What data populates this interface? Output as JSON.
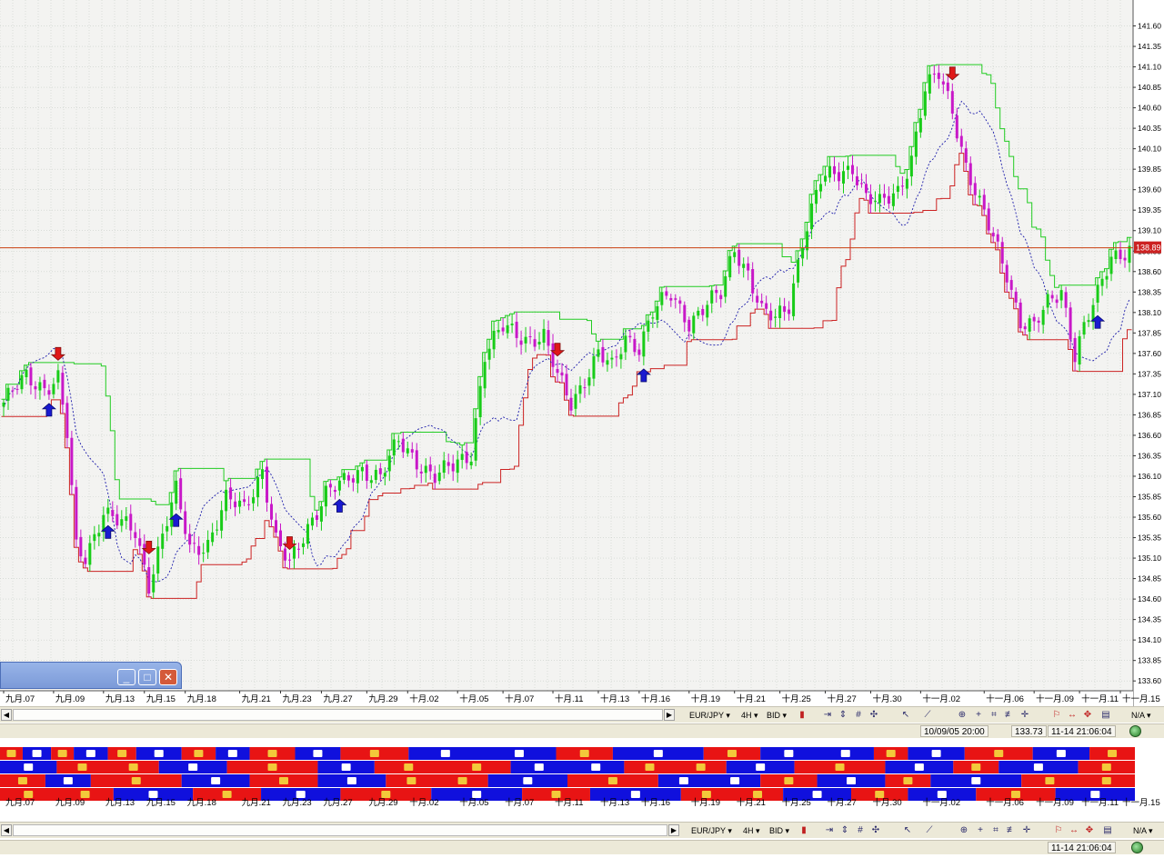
{
  "colors": {
    "background": "#f3f3f1",
    "grid": "#c9cfc9",
    "bull_candle": "#18cc18",
    "bear_candle": "#c818c8",
    "channel_upper": "#22cc22",
    "channel_lower": "#cc2222",
    "stop_line": "#1a1aaa",
    "price_line": "#c84010",
    "price_tag_bg": "#cc2222",
    "heat_bull": "#e81414",
    "heat_bear": "#1010dd"
  },
  "chart_data": {
    "type": "candlestick",
    "symbol": "EUR/JPY",
    "timeframe": "4H",
    "price_side": "BID",
    "y_ticks": [
      "141.60",
      "141.35",
      "141.10",
      "140.85",
      "140.60",
      "140.35",
      "140.10",
      "139.85",
      "139.60",
      "139.35",
      "139.10",
      "138.85",
      "138.60",
      "138.35",
      "138.10",
      "137.85",
      "137.60",
      "137.35",
      "137.10",
      "136.85",
      "136.60",
      "136.35",
      "136.10",
      "135.85",
      "135.60",
      "135.35",
      "135.10",
      "134.85",
      "134.60",
      "134.35",
      "134.10",
      "133.85",
      "133.60"
    ],
    "ylim": [
      133.48,
      141.85
    ],
    "current_price": "138.89",
    "current_price_value": 138.89,
    "x_ticks": [
      {
        "t": 0,
        "label": "九月.07"
      },
      {
        "t": 11,
        "label": "九月.09"
      },
      {
        "t": 22,
        "label": "九月.13"
      },
      {
        "t": 31,
        "label": "九月.15"
      },
      {
        "t": 40,
        "label": "九月.18"
      },
      {
        "t": 52,
        "label": "九月.21"
      },
      {
        "t": 61,
        "label": "九月.23"
      },
      {
        "t": 70,
        "label": "九月.27"
      },
      {
        "t": 80,
        "label": "九月.29"
      },
      {
        "t": 89,
        "label": "十月.02"
      },
      {
        "t": 100,
        "label": "十月.05"
      },
      {
        "t": 110,
        "label": "十月.07"
      },
      {
        "t": 121,
        "label": "十月.11"
      },
      {
        "t": 131,
        "label": "十月.13"
      },
      {
        "t": 140,
        "label": "十月.16"
      },
      {
        "t": 151,
        "label": "十月.19"
      },
      {
        "t": 161,
        "label": "十月.21"
      },
      {
        "t": 171,
        "label": "十月.25"
      },
      {
        "t": 181,
        "label": "十月.27"
      },
      {
        "t": 191,
        "label": "十月.30"
      },
      {
        "t": 202,
        "label": "十一月.02"
      },
      {
        "t": 216,
        "label": "十一月.06"
      },
      {
        "t": 227,
        "label": "十一月.09"
      },
      {
        "t": 237,
        "label": "十一月.11"
      },
      {
        "t": 246,
        "label": "十一月.15"
      }
    ],
    "bars_count": 249,
    "close_waypoints": [
      [
        0,
        137.0
      ],
      [
        5,
        137.3
      ],
      [
        9,
        137.2
      ],
      [
        12,
        137.3
      ],
      [
        14,
        136.6
      ],
      [
        16,
        135.2
      ],
      [
        18,
        135.1
      ],
      [
        22,
        135.7
      ],
      [
        26,
        135.5
      ],
      [
        29,
        135.4
      ],
      [
        32,
        134.8
      ],
      [
        35,
        135.4
      ],
      [
        38,
        135.9
      ],
      [
        41,
        135.2
      ],
      [
        45,
        135.3
      ],
      [
        49,
        135.8
      ],
      [
        53,
        135.7
      ],
      [
        57,
        136.2
      ],
      [
        60,
        135.3
      ],
      [
        63,
        135.0
      ],
      [
        67,
        135.5
      ],
      [
        71,
        135.9
      ],
      [
        75,
        136.0
      ],
      [
        79,
        136.2
      ],
      [
        83,
        136.1
      ],
      [
        87,
        136.5
      ],
      [
        91,
        136.3
      ],
      [
        95,
        136.1
      ],
      [
        99,
        136.2
      ],
      [
        103,
        136.4
      ],
      [
        106,
        137.6
      ],
      [
        110,
        137.9
      ],
      [
        115,
        137.8
      ],
      [
        119,
        137.8
      ],
      [
        122,
        137.3
      ],
      [
        125,
        137.0
      ],
      [
        128,
        137.3
      ],
      [
        131,
        137.6
      ],
      [
        134,
        137.4
      ],
      [
        137,
        137.8
      ],
      [
        140,
        137.7
      ],
      [
        143,
        138.1
      ],
      [
        147,
        138.3
      ],
      [
        151,
        138.0
      ],
      [
        155,
        138.2
      ],
      [
        158,
        138.3
      ],
      [
        161,
        138.9
      ],
      [
        164,
        138.6
      ],
      [
        167,
        138.1
      ],
      [
        170,
        138.0
      ],
      [
        173,
        138.2
      ],
      [
        176,
        139.0
      ],
      [
        180,
        139.7
      ],
      [
        184,
        139.8
      ],
      [
        187,
        139.9
      ],
      [
        190,
        139.5
      ],
      [
        193,
        139.4
      ],
      [
        197,
        139.6
      ],
      [
        200,
        140.0
      ],
      [
        203,
        140.8
      ],
      [
        206,
        141.0
      ],
      [
        209,
        140.6
      ],
      [
        212,
        139.9
      ],
      [
        215,
        139.4
      ],
      [
        218,
        139.0
      ],
      [
        221,
        138.6
      ],
      [
        224,
        138.0
      ],
      [
        227,
        137.9
      ],
      [
        230,
        138.2
      ],
      [
        233,
        138.4
      ],
      [
        236,
        137.6
      ],
      [
        238,
        137.9
      ],
      [
        241,
        138.3
      ],
      [
        244,
        138.8
      ],
      [
        248,
        138.89
      ]
    ],
    "markers": [
      {
        "t": 12,
        "dir": "down"
      },
      {
        "t": 10,
        "dir": "up"
      },
      {
        "t": 23,
        "dir": "up"
      },
      {
        "t": 32,
        "dir": "down"
      },
      {
        "t": 38,
        "dir": "up"
      },
      {
        "t": 63,
        "dir": "down"
      },
      {
        "t": 74,
        "dir": "up"
      },
      {
        "t": 122,
        "dir": "down"
      },
      {
        "t": 141,
        "dir": "up"
      },
      {
        "t": 209,
        "dir": "down"
      },
      {
        "t": 241,
        "dir": "up"
      }
    ],
    "channel_period": 10,
    "has_grid": true,
    "has_legend": false
  },
  "bottom_toolbar": {
    "symbol": "EUR/JPY ▾",
    "timeframe": "4H ▾",
    "price_side": "BID ▾",
    "na_label": "N/A ▾"
  },
  "status": {
    "cursor_time": "10/09/05 20:00",
    "cursor_price": "133.73",
    "clock": "11-14 21:06:04"
  },
  "heatmap": {
    "rows": 4,
    "segments": [
      [
        [
          0,
          0.02,
          1
        ],
        [
          0.02,
          0.045,
          0
        ],
        [
          0.045,
          0.065,
          1
        ],
        [
          0.065,
          0.095,
          0
        ],
        [
          0.095,
          0.12,
          1
        ],
        [
          0.12,
          0.16,
          0
        ],
        [
          0.16,
          0.19,
          1
        ],
        [
          0.19,
          0.22,
          0
        ],
        [
          0.22,
          0.26,
          1
        ],
        [
          0.26,
          0.3,
          0
        ],
        [
          0.3,
          0.36,
          1
        ],
        [
          0.36,
          0.49,
          0
        ],
        [
          0.49,
          0.54,
          1
        ],
        [
          0.54,
          0.62,
          0
        ],
        [
          0.62,
          0.67,
          1
        ],
        [
          0.67,
          0.77,
          0
        ],
        [
          0.77,
          0.8,
          1
        ],
        [
          0.8,
          0.85,
          0
        ],
        [
          0.85,
          0.91,
          1
        ],
        [
          0.91,
          0.96,
          0
        ],
        [
          0.96,
          1,
          1
        ]
      ],
      [
        [
          0,
          0.05,
          0
        ],
        [
          0.05,
          0.14,
          1
        ],
        [
          0.14,
          0.2,
          0
        ],
        [
          0.2,
          0.28,
          1
        ],
        [
          0.28,
          0.33,
          0
        ],
        [
          0.33,
          0.45,
          1
        ],
        [
          0.45,
          0.55,
          0
        ],
        [
          0.55,
          0.64,
          1
        ],
        [
          0.64,
          0.7,
          0
        ],
        [
          0.7,
          0.78,
          1
        ],
        [
          0.78,
          0.84,
          0
        ],
        [
          0.84,
          0.88,
          1
        ],
        [
          0.88,
          0.95,
          0
        ],
        [
          0.95,
          1,
          1
        ]
      ],
      [
        [
          0,
          0.04,
          1
        ],
        [
          0.04,
          0.08,
          0
        ],
        [
          0.08,
          0.16,
          1
        ],
        [
          0.16,
          0.22,
          0
        ],
        [
          0.22,
          0.28,
          1
        ],
        [
          0.28,
          0.34,
          0
        ],
        [
          0.34,
          0.43,
          1
        ],
        [
          0.43,
          0.5,
          0
        ],
        [
          0.5,
          0.58,
          1
        ],
        [
          0.58,
          0.67,
          0
        ],
        [
          0.67,
          0.72,
          1
        ],
        [
          0.72,
          0.78,
          0
        ],
        [
          0.78,
          0.82,
          1
        ],
        [
          0.82,
          0.9,
          0
        ],
        [
          0.9,
          1,
          1
        ]
      ],
      [
        [
          0,
          0.1,
          1
        ],
        [
          0.1,
          0.17,
          0
        ],
        [
          0.17,
          0.23,
          1
        ],
        [
          0.23,
          0.3,
          0
        ],
        [
          0.3,
          0.38,
          1
        ],
        [
          0.38,
          0.46,
          0
        ],
        [
          0.46,
          0.52,
          1
        ],
        [
          0.52,
          0.6,
          0
        ],
        [
          0.6,
          0.69,
          1
        ],
        [
          0.69,
          0.75,
          0
        ],
        [
          0.75,
          0.8,
          1
        ],
        [
          0.8,
          0.86,
          0
        ],
        [
          0.86,
          0.93,
          1
        ],
        [
          0.93,
          1,
          0
        ]
      ]
    ]
  }
}
